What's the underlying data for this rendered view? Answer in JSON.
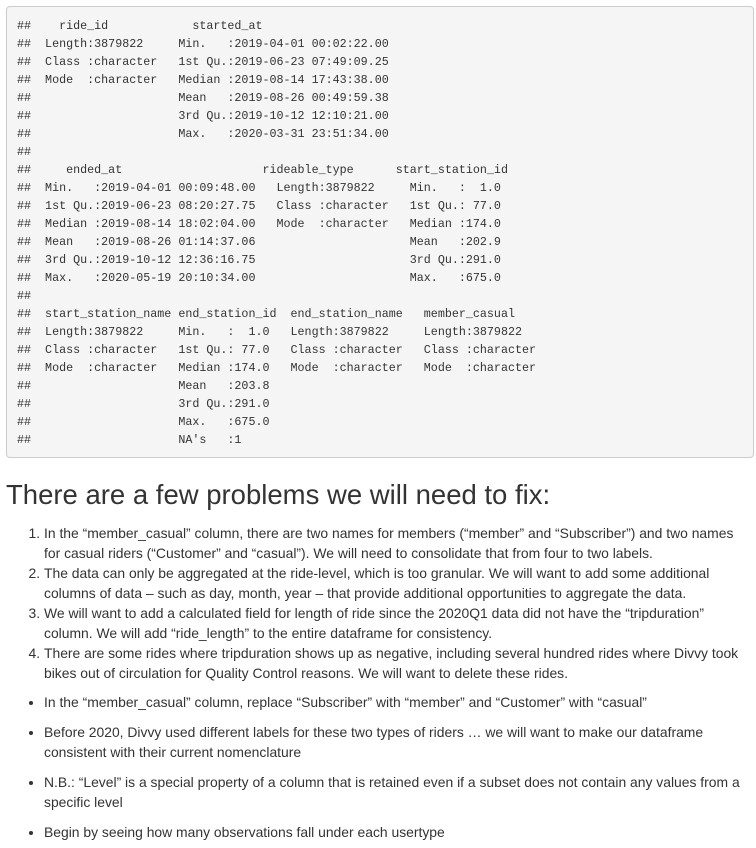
{
  "code_output": {
    "lines": [
      "##    ride_id            started_at                   ",
      "##  Length:3879822     Min.   :2019-04-01 00:02:22.00  ",
      "##  Class :character   1st Qu.:2019-06-23 07:49:09.25  ",
      "##  Mode  :character   Median :2019-08-14 17:43:38.00  ",
      "##                     Mean   :2019-08-26 00:49:59.38  ",
      "##                     3rd Qu.:2019-10-12 12:10:21.00  ",
      "##                     Max.   :2020-03-31 23:51:34.00  ",
      "##                                                     ",
      "##     ended_at                    rideable_type      start_station_id",
      "##  Min.   :2019-04-01 00:09:48.00   Length:3879822     Min.   :  1.0  ",
      "##  1st Qu.:2019-06-23 08:20:27.75   Class :character   1st Qu.: 77.0  ",
      "##  Median :2019-08-14 18:02:04.00   Mode  :character   Median :174.0  ",
      "##  Mean   :2019-08-26 01:14:37.06                      Mean   :202.9  ",
      "##  3rd Qu.:2019-10-12 12:36:16.75                      3rd Qu.:291.0  ",
      "##  Max.   :2020-05-19 20:10:34.00                      Max.   :675.0  ",
      "##                                                                     ",
      "##  start_station_name end_station_id  end_station_name   member_casual     ",
      "##  Length:3879822     Min.   :  1.0   Length:3879822     Length:3879822    ",
      "##  Class :character   1st Qu.: 77.0   Class :character   Class :character  ",
      "##  Mode  :character   Median :174.0   Mode  :character   Mode  :character  ",
      "##                     Mean   :203.8                                        ",
      "##                     3rd Qu.:291.0                                        ",
      "##                     Max.   :675.0                                        ",
      "##                     NA's   :1"
    ]
  },
  "heading": "There are a few problems we will need to fix:",
  "problems": [
    "In the “member_casual” column, there are two names for members (“member” and “Subscriber”) and two names for casual riders (“Customer” and “casual”). We will need to consolidate that from four to two labels.",
    "The data can only be aggregated at the ride-level, which is too granular. We will want to add some additional columns of data – such as day, month, year – that provide additional opportunities to aggregate the data.",
    "We will want to add a calculated field for length of ride since the 2020Q1 data did not have the “tripduration” column. We will add “ride_length” to the entire dataframe for consistency.",
    "There are some rides where tripduration shows up as negative, including several hundred rides where Divvy took bikes out of circulation for Quality Control reasons. We will want to delete these rides."
  ],
  "notes": [
    "In the “member_casual” column, replace “Subscriber” with “member” and “Customer” with “casual”",
    "Before 2020, Divvy used different labels for these two types of riders … we will want to make our dataframe consistent with their current nomenclature",
    "N.B.: “Level” is a special property of a column that is retained even if a subset does not contain any values from a specific level",
    "Begin by seeing how many observations fall under each usertype"
  ]
}
